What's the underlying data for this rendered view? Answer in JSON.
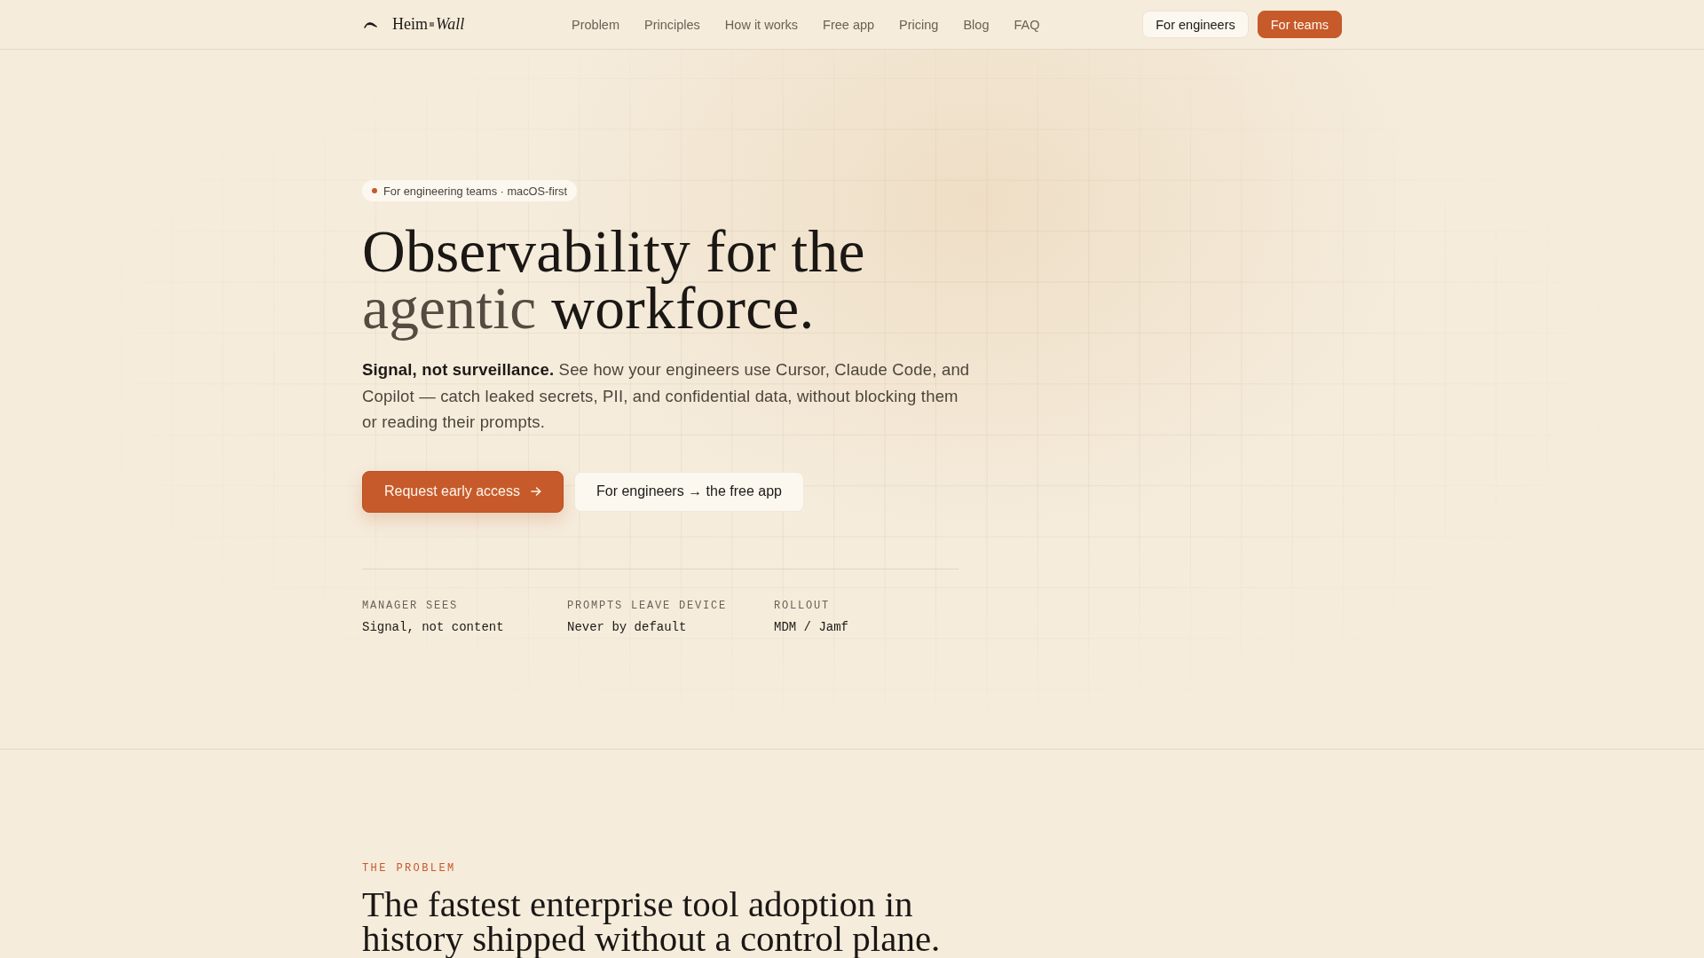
{
  "header": {
    "brand": {
      "name": "Heim",
      "name_italic": "Wall"
    },
    "nav_links": [
      "Problem",
      "Principles",
      "How it works",
      "Free app",
      "Pricing",
      "Blog",
      "FAQ"
    ],
    "buttons": [
      {
        "label": "For engineers",
        "kind": "secondary"
      },
      {
        "label": "For teams",
        "kind": "primary"
      }
    ]
  },
  "hero": {
    "tag": "For engineering teams · macOS-first",
    "title": {
      "before": "Observability for the",
      "accent": "agentic",
      "after": "workforce."
    },
    "lead": "**Signal, not surveillance.** See how your engineers use Cursor, Claude Code, and Copilot — catch leaked secrets, PII, and confidential data, without blocking them or reading their prompts.",
    "buttons": [
      {
        "label": "Request early access",
        "kind": "primary"
      },
      {
        "label": "For engineers → the free app",
        "kind": "secondary"
      }
    ],
    "facts": [
      {
        "label": "MANAGER SEES",
        "value": "Signal, not content"
      },
      {
        "label": "PROMPTS LEAVE DEVICE",
        "value": "Never by default"
      },
      {
        "label": "ROLLOUT",
        "value": "MDM / Jamf"
      }
    ]
  },
  "problem": {
    "eyebrow": "THE PROBLEM",
    "heading": "The fastest enterprise tool adoption in history shipped without a control plane."
  }
}
